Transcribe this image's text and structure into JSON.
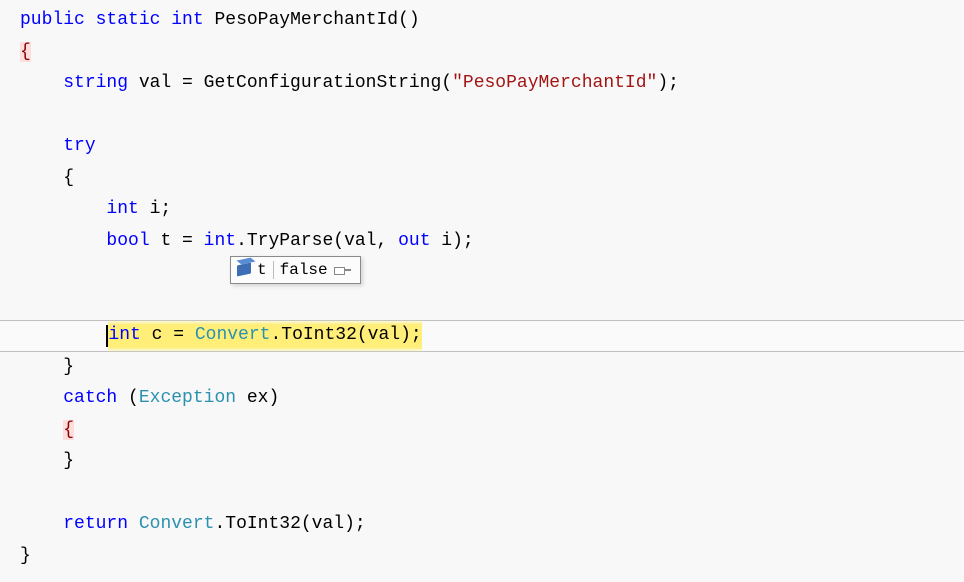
{
  "code": {
    "l1_public": "public",
    "l1_static": "static",
    "l1_int": "int",
    "l1_name": "PesoPayMerchantId()",
    "l2_brace": "{",
    "l3_string": "string",
    "l3_rest1": " val = GetConfigurationString(",
    "l3_str": "\"PesoPayMerchantId\"",
    "l3_rest2": ");",
    "l5_try": "try",
    "l6_brace": "{",
    "l7_int": "int",
    "l7_rest": " i;",
    "l8_bool": "bool",
    "l8_mid": " t = ",
    "l8_inttype": "int",
    "l8_method": ".TryParse(val, ",
    "l8_out": "out",
    "l8_rest": " i);",
    "l9_int": "int",
    "l9_mid": " c = ",
    "l9_convert": "Convert",
    "l9_rest": ".ToInt32(val);",
    "l10_brace": "}",
    "l11_catch": "catch",
    "l11_paren1": " (",
    "l11_exception": "Exception",
    "l11_rest": " ex)",
    "l12_brace": "{",
    "l13_brace": "}",
    "l15_return": "return",
    "l15_sp": " ",
    "l15_convert": "Convert",
    "l15_rest": ".ToInt32(val);",
    "l16_brace": "}"
  },
  "datatip": {
    "var": "t",
    "value": "false"
  }
}
